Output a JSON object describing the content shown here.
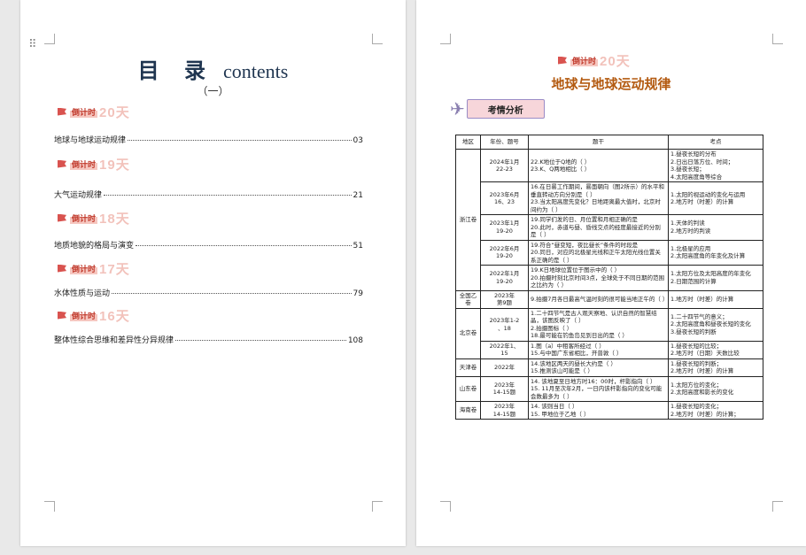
{
  "toc": {
    "title_cn": "目 录",
    "title_en": "contents",
    "subtitle": "（一）",
    "sections": [
      {
        "badge_text": "倒计时",
        "badge_num": "20天",
        "entry": "地球与地球运动规律",
        "page": "03"
      },
      {
        "badge_text": "倒计时",
        "badge_num": "19天",
        "entry": "大气运动规律",
        "page": "21"
      },
      {
        "badge_text": "倒计时",
        "badge_num": "18天",
        "entry": "地质地貌的格局与演变",
        "page": "51"
      },
      {
        "badge_text": "倒计时",
        "badge_num": "17天",
        "entry": "水体性质与运动",
        "page": "79"
      },
      {
        "badge_text": "倒计时",
        "badge_num": "16天",
        "entry": "整体性综合思维和差异性分异规律",
        "page": "108"
      }
    ]
  },
  "page2": {
    "badge_text": "倒计时",
    "badge_num": "20天",
    "title": "地球与地球运动规律",
    "analysis_label": "考情分析",
    "table": {
      "headers": [
        "地区",
        "年份、题号",
        "题干",
        "考点"
      ],
      "regions": [
        {
          "name": "浙江卷",
          "rows": [
            {
              "year": [
                "2024年1月",
                "22-23"
              ],
              "stem": [
                "22.K地位于Q地的（ ）",
                "23.K、Q两地相比（ ）"
              ],
              "points": [
                "1.昼夜长短的分布",
                "2.日出日落方位、时间；",
                "3.昼夜长短；",
                "4.太阳高度角等综合"
              ]
            },
            {
              "year": [
                "2023年6月",
                "16、23"
              ],
              "stem": [
                "16.在日晷工作期间，晷面朝向（图2所示）的水平和垂直转动方向分别是（ ）",
                "23.当太阳高度先变化？日地距离最大值时，北京时间约为（ ）"
              ],
              "points": [
                "1.太阳的视运动的变化与运用",
                "2.地方时（时差）的计算"
              ]
            },
            {
              "year": [
                "2023年1月",
                "19-20"
              ],
              "stem": [
                "19.同学们发的日、月位置和月相正确的是",
                "20.此时，赤道与昼、昏线交点的经度最接近的分别是（ ）"
              ],
              "points": [
                "1.天体的判读",
                "2.地方时的判读"
              ]
            },
            {
              "year": [
                "2022年6月",
                "19-20"
              ],
              "stem": [
                "19.符合“昼变短，夜比昼长”条件的时段是",
                "20.同日，对应的北极星光线和正午太阳光线位置关系正确的是（ ）"
              ],
              "points": [
                "1.北极星的应用",
                "2.太阳高度角的年变化及计算"
              ]
            },
            {
              "year": [
                "2022年1月",
                "19-20"
              ],
              "stem": [
                "19.K日地球位置位于图示中的（ ）",
                "20.拍摄时刻北京时间3点，全球处于不同日期的范围之比约为（ ）"
              ],
              "points": [
                "1.太阳方位及太阳高度的年变化",
                "2.日期范围的计算"
              ]
            }
          ]
        },
        {
          "name": "全国乙卷",
          "rows": [
            {
              "year": [
                "2023年",
                "第9题"
              ],
              "stem": [
                "9.拍摄7月各日最高气温时刻的很可能当地正午的（ ）"
              ],
              "points": [
                "1.地方时（时差）的计算"
              ]
            }
          ]
        },
        {
          "name": "北京卷",
          "rows": [
            {
              "year": [
                "2023年1-2",
                "、18"
              ],
              "stem": [
                "1.二十四节气是古人观天察地、认识自然的智慧结晶，该图反映了（ ）",
                "2.拍摄图标（ ）",
                "18.最可能在钓鱼岛见到日出的是（ ）"
              ],
              "points": [
                "1.二十四节气的意义；",
                "2.太阳高度角和昼夜长短的变化",
                "3.昼夜长短的判断"
              ]
            },
            {
              "year": [
                "2022年1、",
                "15"
              ],
              "stem": [
                "1.图（a）中租客所经过（ ）",
                "15.与中国广东省相比，开普敦（ ）"
              ],
              "points": [
                "1.昼夜长短的比较；",
                "2.地方时（日期）天数比较"
              ]
            }
          ]
        },
        {
          "name": "天津卷",
          "rows": [
            {
              "year": [
                "2022年"
              ],
              "stem": [
                "14.该地区两天的昼长大约是（ ）",
                "15.推测该山可能是（ ）"
              ],
              "points": [
                "1.昼夜长短的判断；",
                "2.地方时（时差）的计算"
              ]
            }
          ]
        },
        {
          "name": "山东卷",
          "rows": [
            {
              "year": [
                "2023年",
                "14-15题"
              ],
              "stem": [
                "14. 该地夏至日地方时16：00时，杆影指向（ ）",
                "15. 11月至次年2月，一日内该杆影指向的变化可能会数最多为（ ）"
              ],
              "points": [
                "1.太阳方位的变化；",
                "2.太阳高度和影长的变化"
              ]
            }
          ]
        },
        {
          "name": "海南卷",
          "rows": [
            {
              "year": [
                "2023年",
                "14-15题"
              ],
              "stem": [
                "14. 该则当日（ ）",
                "15. 甲地位于乙地（ ）"
              ],
              "points": [
                "1.昼夜长短的变化；",
                "2.地方时（时差）的计算；"
              ]
            }
          ]
        }
      ]
    }
  }
}
